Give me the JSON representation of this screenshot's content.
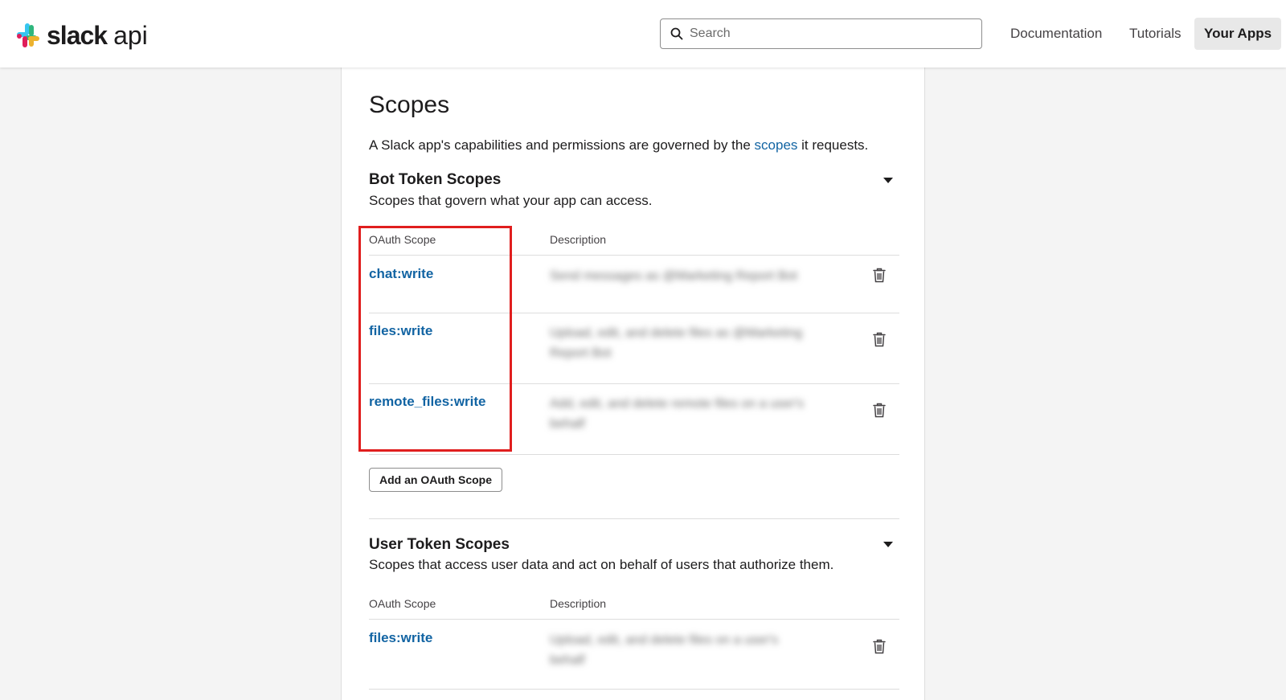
{
  "header": {
    "brand_word": "slack",
    "brand_api": "api",
    "search_placeholder": "Search",
    "nav": {
      "documentation": "Documentation",
      "tutorials": "Tutorials",
      "your_apps": "Your Apps"
    }
  },
  "page": {
    "title": "Scopes",
    "intro_before": "A Slack app's capabilities and permissions are governed by the ",
    "intro_link": "scopes",
    "intro_after": " it requests."
  },
  "bot_section": {
    "title": "Bot Token Scopes",
    "description": "Scopes that govern what your app can access.",
    "col_scope": "OAuth Scope",
    "col_description": "Description",
    "rows": [
      {
        "scope": "chat:write",
        "description": "Send messages as @Marketing Report Bot"
      },
      {
        "scope": "files:write",
        "description": "Upload, edit, and delete files as @Marketing Report Bot"
      },
      {
        "scope": "remote_files:write",
        "description": "Add, edit, and delete remote files on a user's behalf"
      }
    ],
    "add_button": "Add an OAuth Scope"
  },
  "user_section": {
    "title": "User Token Scopes",
    "description": "Scopes that access user data and act on behalf of users that authorize them.",
    "col_scope": "OAuth Scope",
    "col_description": "Description",
    "rows": [
      {
        "scope": "files:write",
        "description": "Upload, edit, and delete files on a user's behalf"
      }
    ]
  },
  "colors": {
    "link": "#1264a3",
    "highlight": "#e01e1e",
    "logo_blue": "#36c5f0",
    "logo_green": "#2eb67d",
    "logo_yellow": "#ecb22e",
    "logo_red": "#e01e5a"
  },
  "icons": {
    "logo": "slack-logo-icon",
    "search": "search-icon",
    "trash": "trash-icon",
    "caret": "caret-down-icon"
  }
}
